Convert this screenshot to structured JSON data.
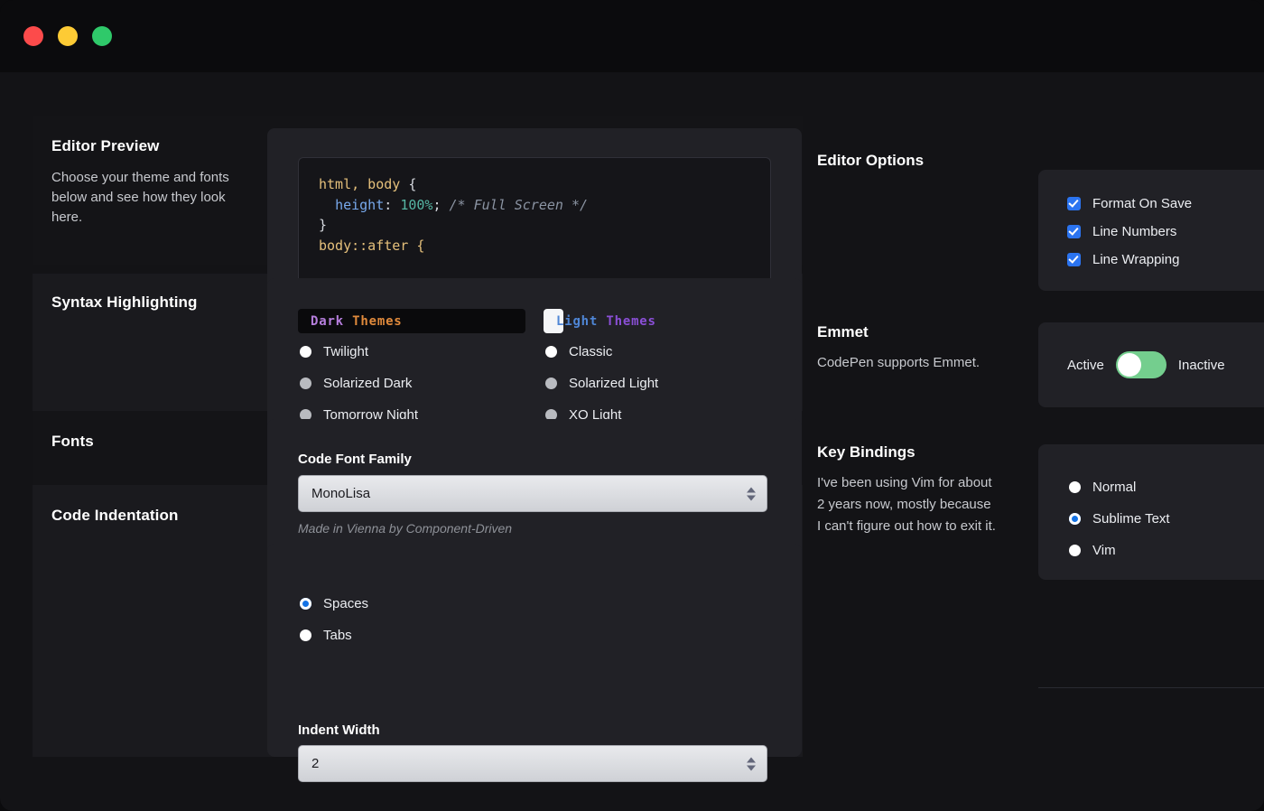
{
  "window": {
    "lights": [
      "close-red",
      "minimize-yellow",
      "zoom-green"
    ]
  },
  "left_sections": [
    {
      "title": "Editor Preview",
      "description": "Choose your theme and fonts below and see how they look here."
    },
    {
      "title": "Syntax Highlighting",
      "description": ""
    },
    {
      "title": "Fonts",
      "description": ""
    },
    {
      "title": "Code Indentation",
      "description": ""
    }
  ],
  "code_preview": {
    "line1_selector": "html, body",
    "line1_brace": " {",
    "line2_indent": "  ",
    "line2_property": "height",
    "line2_colon": ": ",
    "line2_value": "100%",
    "line2_semicolon": "; ",
    "line2_comment": "/* Full Screen */",
    "line3": "}",
    "line4": "body::after {"
  },
  "themes": {
    "dark": {
      "head_word1": "Dark",
      "head_word2": "Themes",
      "options": [
        {
          "label": "Twilight",
          "state": "on"
        },
        {
          "label": "Solarized Dark",
          "state": "dim"
        },
        {
          "label": "Tomorrow Night",
          "state": "dim"
        }
      ]
    },
    "light": {
      "head_word1": "Light",
      "head_word2": "Themes",
      "options": [
        {
          "label": "Classic",
          "state": "on"
        },
        {
          "label": "Solarized Light",
          "state": "dim"
        },
        {
          "label": "XQ Light",
          "state": "dim"
        }
      ]
    }
  },
  "fonts": {
    "field_label": "Code Font Family",
    "selected_value": "MonoLisa",
    "caption": "Made in Vienna by Component-Driven"
  },
  "indentation": {
    "options": [
      {
        "label": "Spaces",
        "selected": true
      },
      {
        "label": "Tabs",
        "selected": false
      }
    ],
    "width_label": "Indent Width",
    "width_value": "2"
  },
  "editor_options": {
    "title": "Editor Options",
    "checkboxes": [
      {
        "label": "Format On Save",
        "checked": true
      },
      {
        "label": "Line Numbers",
        "checked": true
      },
      {
        "label": "Line Wrapping",
        "checked": true
      }
    ]
  },
  "emmet": {
    "title": "Emmet",
    "description": "CodePen supports Emmet.",
    "toggle_left_label": "Active",
    "toggle_right_label": "Inactive",
    "toggle_state": "left"
  },
  "key_bindings": {
    "title": "Key Bindings",
    "description": "I've been using Vim for about 2 years now, mostly because I can't figure out how to exit it.",
    "options": [
      {
        "label": "Normal",
        "selected": false
      },
      {
        "label": "Sublime Text",
        "selected": true
      },
      {
        "label": "Vim",
        "selected": false
      }
    ]
  },
  "colors": {
    "accent_blue": "#2b74f0",
    "toggle_green": "#74ce8e",
    "radio_selected": "#1473e6",
    "panel": "#212126",
    "background": "#131316"
  }
}
